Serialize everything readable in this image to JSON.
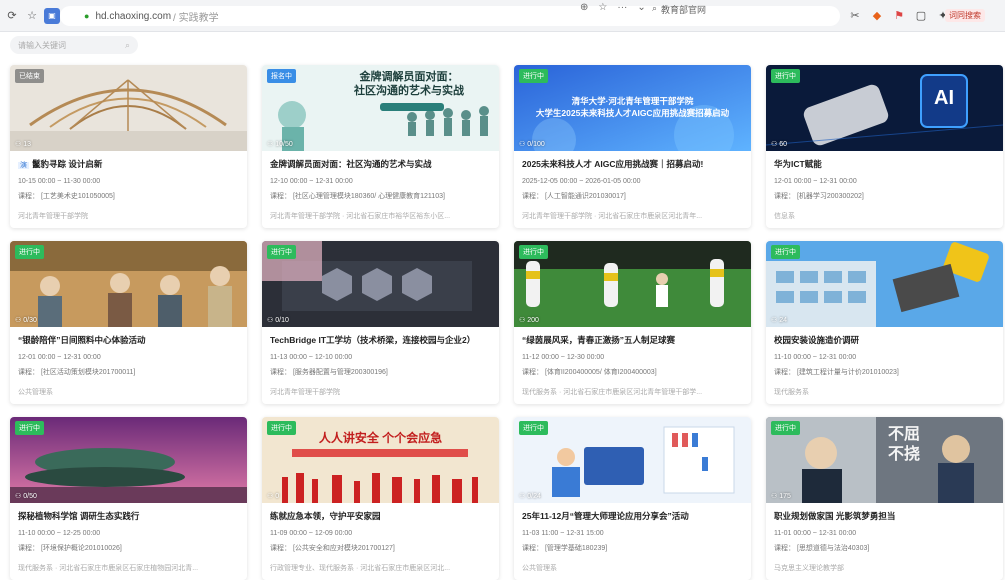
{
  "browser": {
    "url_host": "hd.chaoxing.com",
    "url_path": "/ 实践教学",
    "search_text": "教育部官网",
    "ext_badge": "词同搜索"
  },
  "search": {
    "placeholder": "请输入关键词"
  },
  "cards": [
    {
      "status": "已结束",
      "count": "13",
      "tag": "演",
      "title": "鬣豹寻踪  设计启新",
      "time": "10-15 00:00 ~ 11-30 00:00",
      "course": "课程：  [工艺美术史101050005]",
      "org": "河北青年管理干部学院"
    },
    {
      "status": "报名中",
      "count": "10/50",
      "overlay": "金牌调解员面对面：\n社区沟通的艺术与实战",
      "title": "金牌调解员面对面：社区沟通的艺术与实战",
      "time": "12-10 00:00 ~ 12-31 00:00",
      "course": "课程：  [社区心理管理模块180360/ 心理健康教育121103]",
      "org": "河北青年管理干部学院 · 河北省石家庄市裕华区裕东小区..."
    },
    {
      "status": "进行中",
      "count": "0/100",
      "overlay": "清华大学·河北青年管理干部学院\n大学生2025未来科技人才AIGC应用挑战赛招募启动",
      "title": "2025未来科技人才  AIGC应用挑战赛｜招募启动!",
      "time": "2025-12-05 00:00 ~ 2026-01-05 00:00",
      "course": "课程：  [人工智能通识201030017]",
      "org": "河北青年管理干部学院 · 河北省石家庄市鹿泉区河北青年..."
    },
    {
      "status": "进行中",
      "count": "60",
      "overlay": "AI",
      "title": "华为ICT赋能",
      "time": "12-01 00:00 ~ 12-31 00:00",
      "course": "课程：  [机器学习200300202]",
      "org": "信息系"
    },
    {
      "status": "进行中",
      "count": "0/30",
      "title": "“银龄陪伴”日间照料中心体验活动",
      "time": "12-01 00:00 ~ 12-31 00:00",
      "course": "课程：  [社区活动策划模块201700011]",
      "org": "公共管理系"
    },
    {
      "status": "进行中",
      "count": "0/10",
      "title": "TechBridge IT工学坊（技术桥梁，连接校园与企业2）",
      "time": "11-13 00:00 ~ 12-10 00:00",
      "course": "课程：  [服务器配置与管理200300196]",
      "org": "河北青年管理干部学院"
    },
    {
      "status": "进行中",
      "count": "200",
      "title": "“绿茵展风采，青春正激扬”五人制足球赛",
      "time": "11-12 00:00 ~ 12-30 00:00",
      "course": "课程：  [体育II200400005/ 体育I200400003]",
      "org": "现代服务系 · 河北省石家庄市鹿泉区河北青年管理干部学..."
    },
    {
      "status": "进行中",
      "count": "24",
      "title": "校园安装设施造价调研",
      "time": "11-10 00:00 ~ 12-31 00:00",
      "course": "课程：  [建筑工程计量与计价201010023]",
      "org": "现代服务系"
    },
    {
      "status": "进行中",
      "count": "0/50",
      "title": "探秘植物科学馆  调研生态实践行",
      "time": "11-10 00:00 ~ 12-25 00:00",
      "course": "课程：  [环境保护概论201010026]",
      "org": "现代服务系 · 河北省石家庄市鹿泉区石家庄植物园河北青..."
    },
    {
      "status": "进行中",
      "count": "0",
      "overlay": "人人讲安全  个个会应急",
      "title": "练就应急本领，守护平安家园",
      "time": "11-09 00:00 ~ 12-09 00:00",
      "course": "课程：  [公共安全和应对模块201700127]",
      "org": "行政管理专业、现代服务系 · 河北省石家庄市鹿泉区河北..."
    },
    {
      "status": "进行中",
      "count": "0/24",
      "title": "25年11-12月“管理大师理论应用分享会”活动",
      "time": "11-03 11:00 ~ 12-31 15:00",
      "course": "课程：  [管理学基础180239]",
      "org": "公共管理系"
    },
    {
      "status": "进行中",
      "count": "175",
      "overlay": "不屈\n不挠",
      "title": "职业规划做家国  光影筑梦勇担当",
      "time": "11-01 00:00 ~ 12-31 00:00",
      "course": "课程：  [思想道德与法治40303]",
      "org": "马克思主义理论教学部"
    }
  ]
}
